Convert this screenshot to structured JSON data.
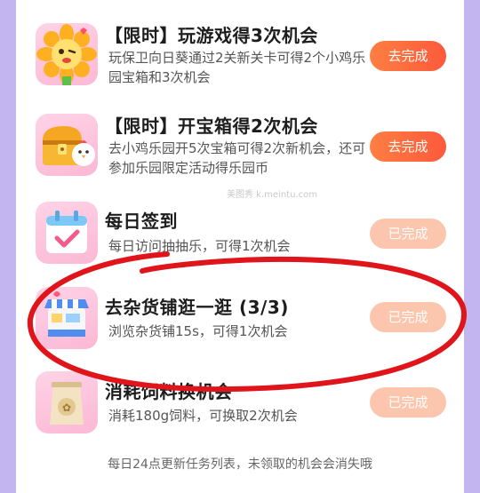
{
  "tasks": [
    {
      "title": "【限时】玩游戏得3次机会",
      "desc": "玩保卫向日葵通过2关新关卡可得2个小鸡乐园宝箱和3次机会",
      "button": "去完成",
      "status": "active",
      "icon": "sunflower-icon"
    },
    {
      "title": "【限时】开宝箱得2次机会",
      "desc": "去小鸡乐园开5次宝箱可得2次新机会，还可参加乐园限定活动得乐园币",
      "button": "去完成",
      "status": "active",
      "icon": "treasure-chest-icon"
    },
    {
      "title": "每日签到",
      "desc": "每日访问抽抽乐，可得1次机会",
      "button": "已完成",
      "status": "done",
      "icon": "calendar-check-icon"
    },
    {
      "title": "去杂货铺逛一逛 (3/3)",
      "desc": "浏览杂货铺15s，可得1次机会",
      "button": "已完成",
      "status": "done",
      "icon": "shop-stall-icon"
    },
    {
      "title": "消耗饲料换机会",
      "desc": "消耗180g饲料，可换取2次机会",
      "button": "已完成",
      "status": "done",
      "icon": "feed-bag-icon"
    }
  ],
  "footer": "每日24点更新任务列表，未领取的机会会消失哦",
  "watermark": "美图秀 k.meintu.com",
  "colors": {
    "active_button": "#fb6a3e",
    "done_button": "#fbc6ad",
    "icon_tile": "#fbc3dc",
    "annotation": "#e0141b",
    "page_background": "#c3b5f0"
  }
}
